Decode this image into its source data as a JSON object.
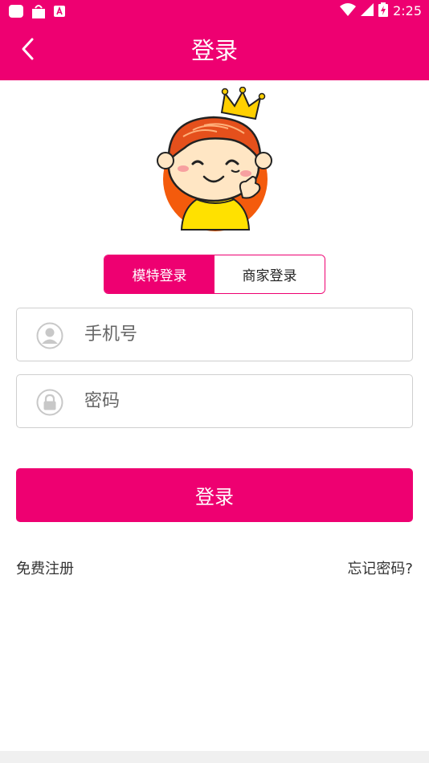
{
  "status_bar": {
    "time": "2:25",
    "icons": [
      "app-notification-icon",
      "android-bag-icon",
      "a-letter-icon",
      "wifi-icon",
      "signal-icon",
      "battery-icon"
    ]
  },
  "app_bar": {
    "title": "登录",
    "back_icon": "chevron-left-icon"
  },
  "login_type_tabs": [
    {
      "label": "模特登录",
      "active": true
    },
    {
      "label": "商家登录",
      "active": false
    }
  ],
  "form": {
    "phone": {
      "placeholder": "手机号",
      "value": "",
      "icon": "user-icon"
    },
    "password": {
      "placeholder": "密码",
      "value": "",
      "icon": "lock-icon"
    }
  },
  "submit_label": "登录",
  "links": {
    "register": "免费注册",
    "forgot_password": "忘记密码?"
  },
  "colors": {
    "brand": "#ee0071",
    "border": "#cfcfcf",
    "text": "#333333"
  }
}
